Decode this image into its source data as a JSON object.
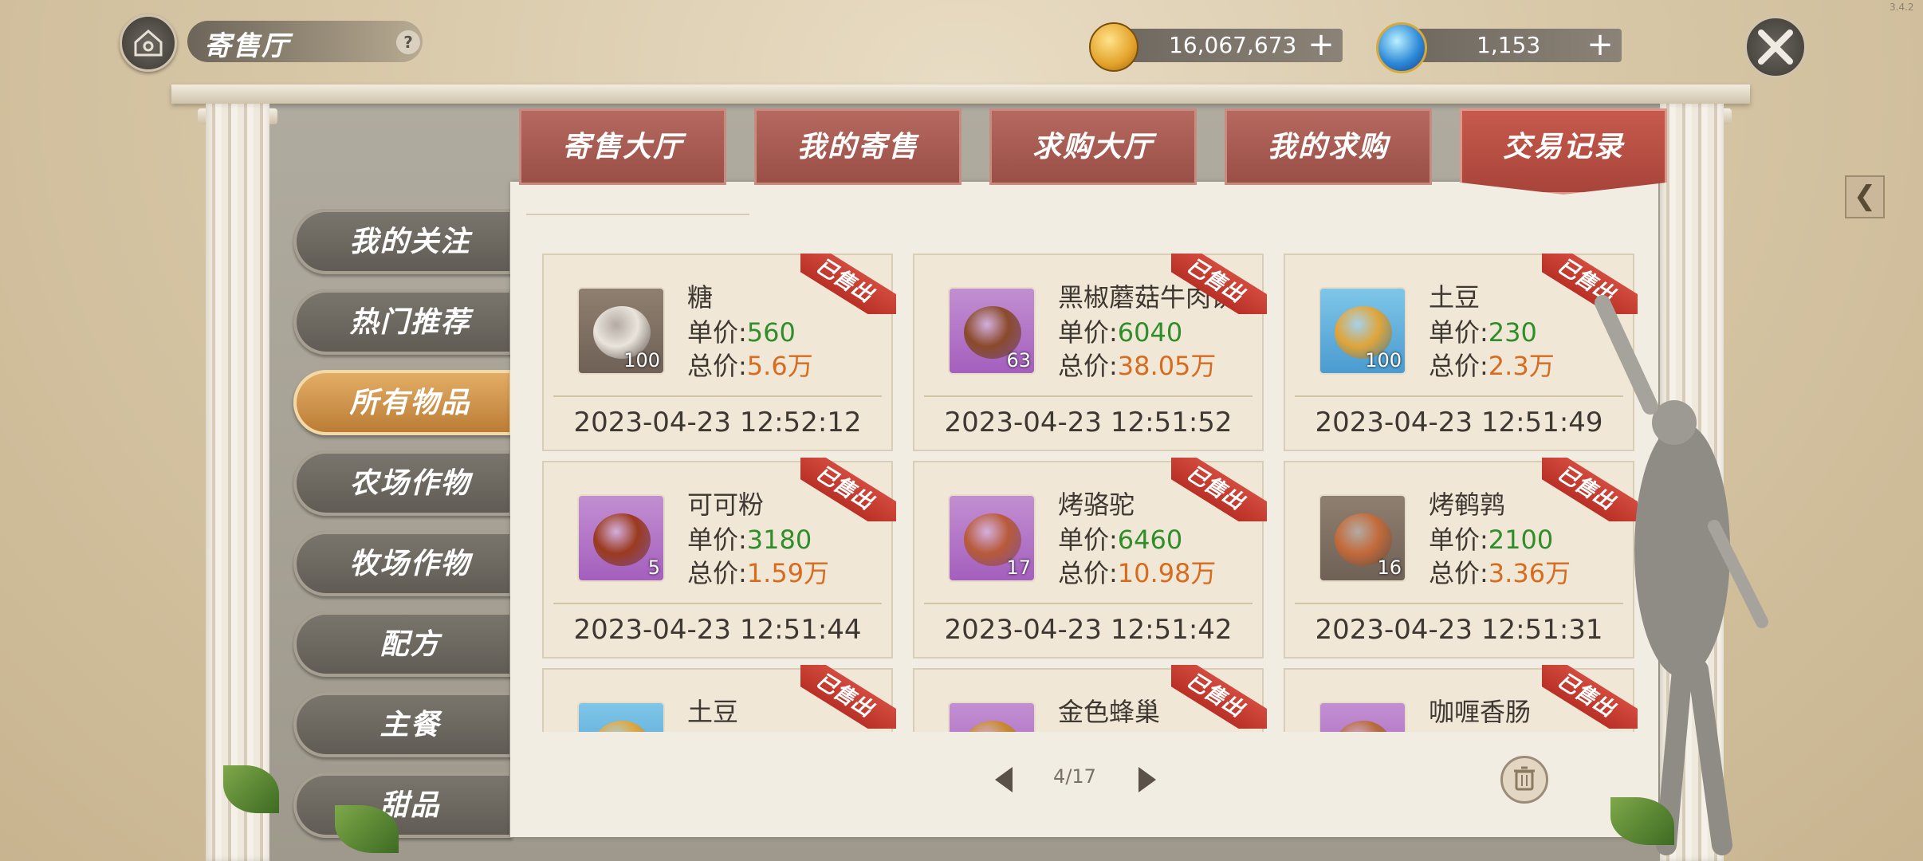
{
  "header": {
    "title": "寄售厅",
    "help_label": "?",
    "gold": "16,067,673",
    "diamond": "1,153",
    "version": "3.4.2"
  },
  "tabs": [
    {
      "label": "寄售大厅",
      "active": false
    },
    {
      "label": "我的寄售",
      "active": false
    },
    {
      "label": "求购大厅",
      "active": false
    },
    {
      "label": "我的求购",
      "active": false
    },
    {
      "label": "交易记录",
      "active": true
    }
  ],
  "sidebar": [
    {
      "label": "我的关注"
    },
    {
      "label": "热门推荐"
    },
    {
      "label": "所有物品",
      "active": true
    },
    {
      "label": "农场作物"
    },
    {
      "label": "牧场作物"
    },
    {
      "label": "配方"
    },
    {
      "label": "主餐"
    },
    {
      "label": "甜品"
    }
  ],
  "labels": {
    "unit_price": "单价:",
    "total_price": "总价:",
    "sold": "已售出"
  },
  "records": [
    {
      "name": "糖",
      "qty": "100",
      "unit": "560",
      "total": "5.6万",
      "time": "2023-04-23 12:52:12",
      "bg": "gray"
    },
    {
      "name": "黑椒蘑菇牛肉饼",
      "qty": "63",
      "unit": "6040",
      "total": "38.05万",
      "time": "2023-04-23 12:51:52",
      "bg": "purple"
    },
    {
      "name": "土豆",
      "qty": "100",
      "unit": "230",
      "total": "2.3万",
      "time": "2023-04-23 12:51:49",
      "bg": "blue"
    },
    {
      "name": "可可粉",
      "qty": "5",
      "unit": "3180",
      "total": "1.59万",
      "time": "2023-04-23 12:51:44",
      "bg": "purple"
    },
    {
      "name": "烤骆驼",
      "qty": "17",
      "unit": "6460",
      "total": "10.98万",
      "time": "2023-04-23 12:51:42",
      "bg": "purple"
    },
    {
      "name": "烤鹌鹑",
      "qty": "16",
      "unit": "2100",
      "total": "3.36万",
      "time": "2023-04-23 12:51:31",
      "bg": "gray"
    },
    {
      "name": "土豆",
      "qty": "",
      "unit": "",
      "total": "",
      "time": "",
      "bg": "blue"
    },
    {
      "name": "金色蜂巢",
      "qty": "",
      "unit": "",
      "total": "",
      "time": "",
      "bg": "purple"
    },
    {
      "name": "咖喱香肠",
      "qty": "",
      "unit": "",
      "total": "",
      "time": "",
      "bg": "purple"
    }
  ],
  "pager": {
    "text": "4/17"
  }
}
